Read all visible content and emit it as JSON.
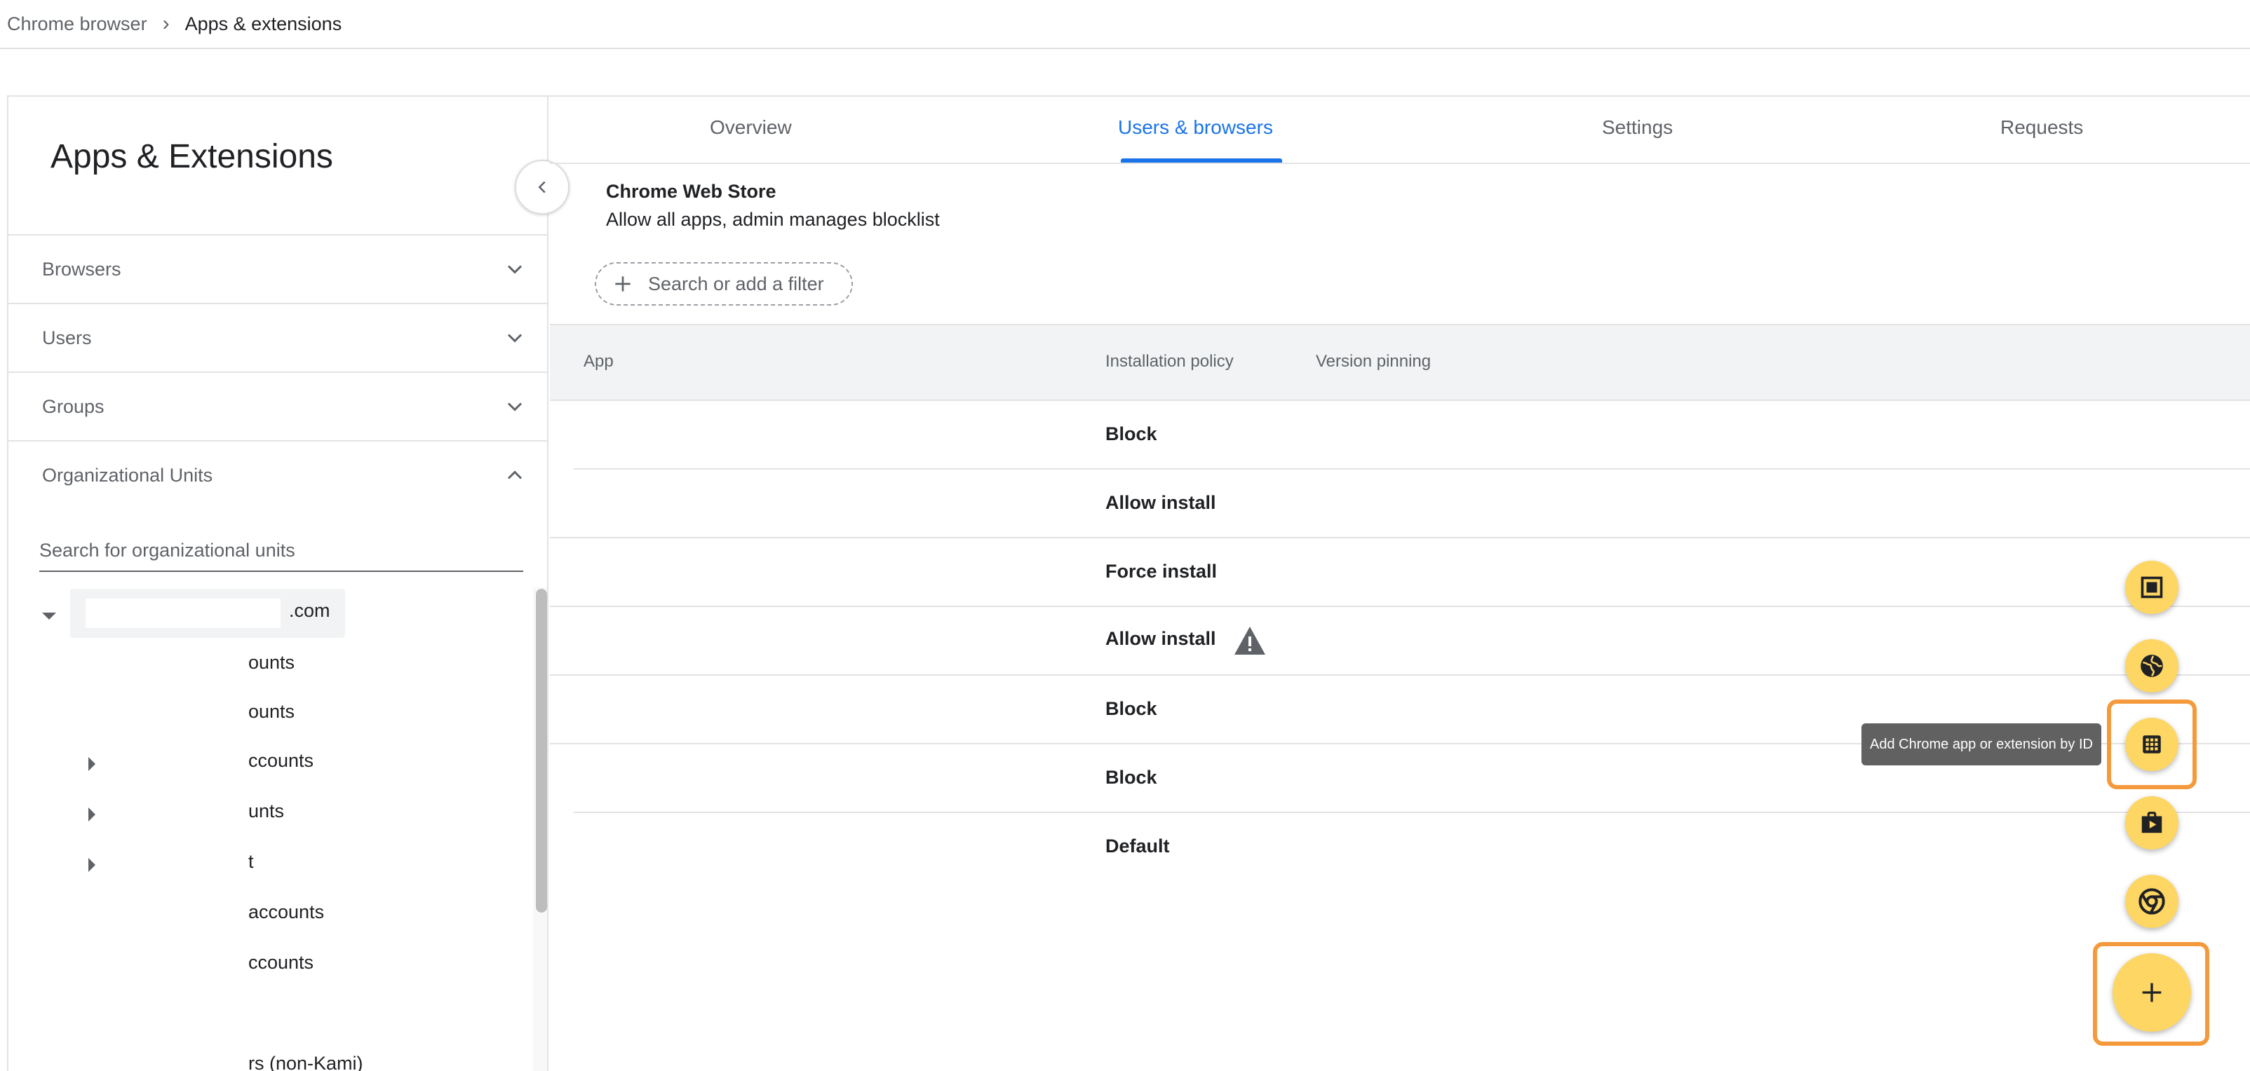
{
  "breadcrumb": {
    "parent": "Chrome browser",
    "separator": "›",
    "current": "Apps & extensions"
  },
  "sidebar": {
    "title": "Apps & Extensions",
    "sections": [
      {
        "label": "Browsers",
        "expanded": false
      },
      {
        "label": "Users",
        "expanded": false
      },
      {
        "label": "Groups",
        "expanded": false
      },
      {
        "label": "Organizational Units",
        "expanded": true
      }
    ],
    "ou_search_placeholder": "Search for organizational units",
    "tree_root_label": ".com",
    "tree_items": [
      "ounts",
      "ounts",
      "ccounts",
      "unts",
      "t",
      "accounts",
      "ccounts",
      "rs (non-Kami)"
    ]
  },
  "tabs": [
    {
      "label": "Overview",
      "active": false
    },
    {
      "label": "Users & browsers",
      "active": true
    },
    {
      "label": "Settings",
      "active": false
    },
    {
      "label": "Requests",
      "active": false
    }
  ],
  "store": {
    "title": "Chrome Web Store",
    "subtitle": "Allow all apps, admin manages blocklist"
  },
  "filter": {
    "placeholder": "Search or add a filter"
  },
  "table": {
    "columns": [
      "App",
      "Installation policy",
      "Version pinning"
    ],
    "rows": [
      {
        "policy": "Block",
        "warning": false
      },
      {
        "policy": "Allow install",
        "warning": false
      },
      {
        "policy": "Force install",
        "warning": false
      },
      {
        "policy": "Allow install",
        "warning": true
      },
      {
        "policy": "Block",
        "warning": false
      },
      {
        "policy": "Block",
        "warning": false
      },
      {
        "policy": "Default",
        "warning": false
      }
    ]
  },
  "fab_menu": {
    "tooltip": "Add Chrome app or extension by ID",
    "items": [
      {
        "icon": "kiosk-app-icon"
      },
      {
        "icon": "globe-icon"
      },
      {
        "icon": "dialpad-id-icon"
      },
      {
        "icon": "play-store-bag-icon"
      },
      {
        "icon": "chrome-icon"
      }
    ],
    "main_icon": "plus-icon"
  },
  "colors": {
    "accent": "#1a73e8",
    "fab": "#fdd663",
    "highlight": "#f59a3c",
    "tooltip_bg": "#616161"
  }
}
